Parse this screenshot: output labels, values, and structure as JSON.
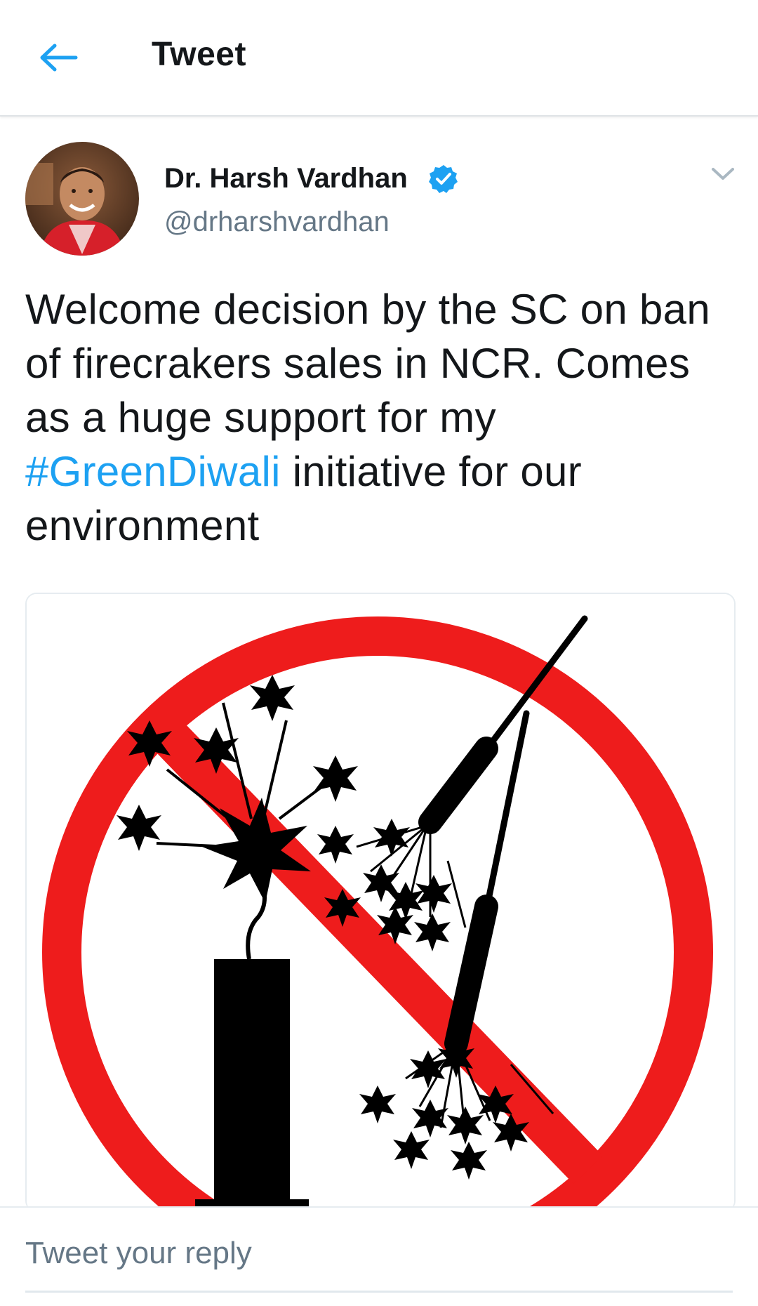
{
  "header": {
    "title": "Tweet",
    "back_icon": "arrow-left-icon",
    "accent_color": "#1da1f2"
  },
  "tweet": {
    "author_name": "Dr. Harsh Vardhan",
    "handle": "@drharshvardhan",
    "verified": true,
    "text_part1": "Welcome decision by the SC on ban of firecrakers sales in NCR. Comes as a huge support for my ",
    "hashtag": "#GreenDiwali",
    "text_part2": " initiative for our environment",
    "media_description_icon": "no-firecrackers-sign"
  },
  "reply": {
    "placeholder": "Tweet your reply"
  }
}
